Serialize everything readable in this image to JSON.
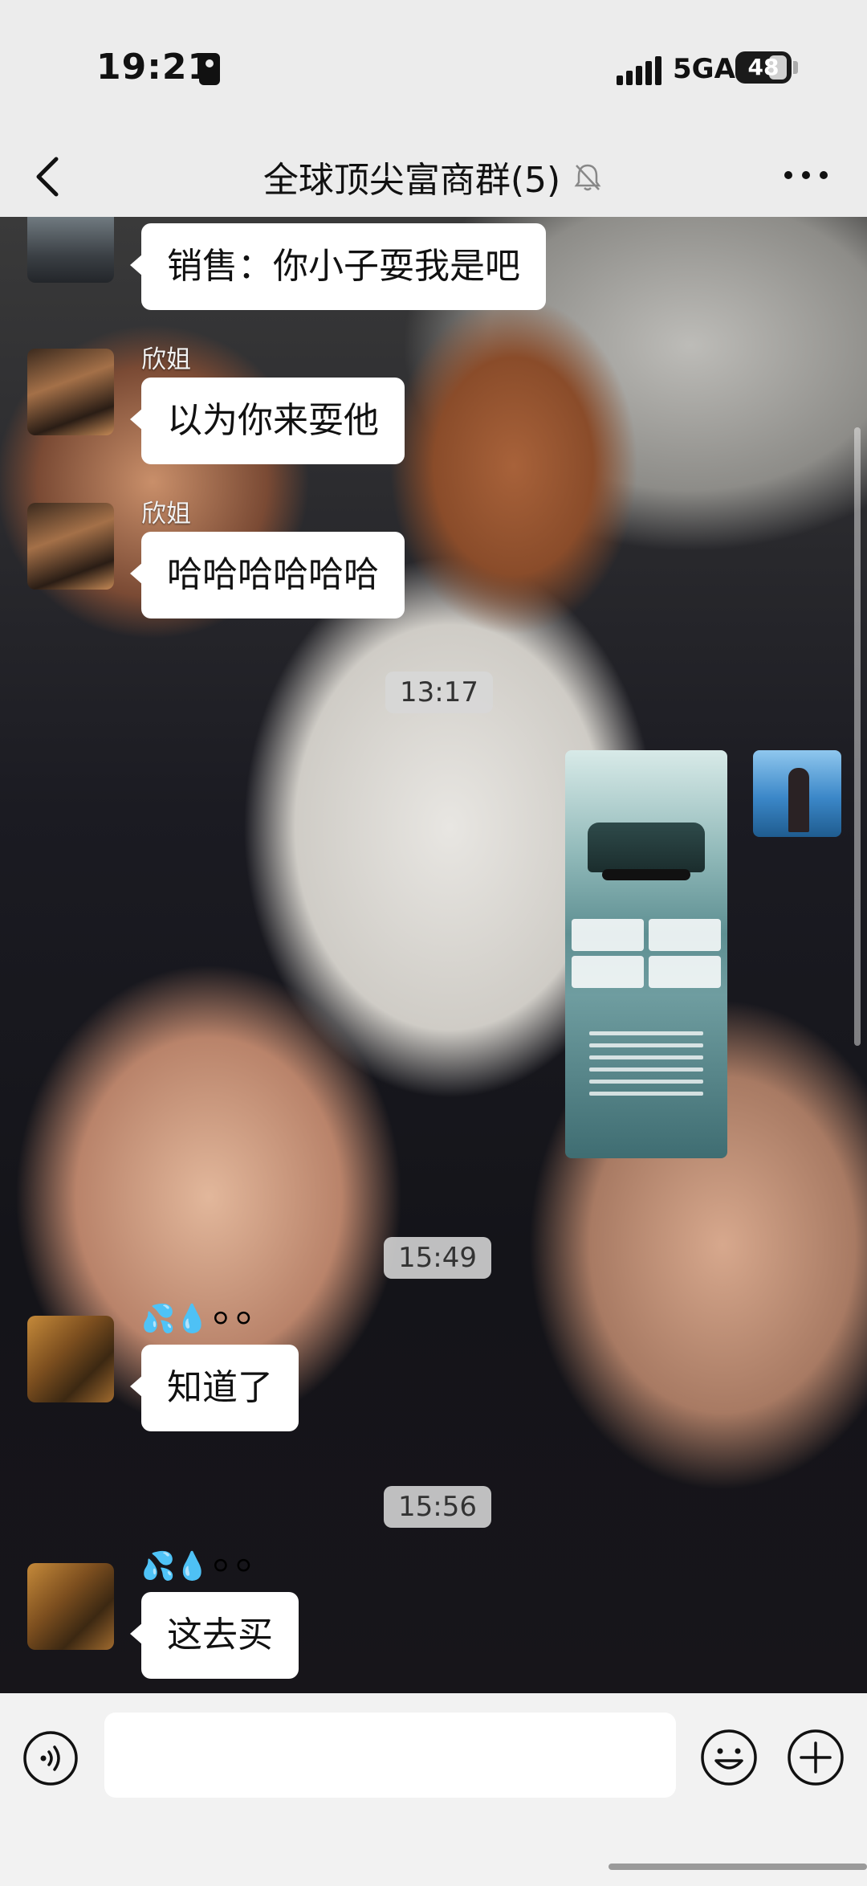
{
  "status_bar": {
    "time": "19:21",
    "network": "5GA",
    "battery": "48"
  },
  "header": {
    "title": "全球顶尖富商群(5)",
    "muted_icon": "bell-off-icon",
    "more_icon": "more-icon"
  },
  "messages": [
    {
      "type": "text",
      "sender": "",
      "text": "销售：你小子耍我是吧"
    },
    {
      "type": "text",
      "sender": "欣姐",
      "text": "以为你来耍他"
    },
    {
      "type": "text",
      "sender": "欣姐",
      "text": "哈哈哈哈哈哈"
    },
    {
      "type": "time",
      "text": "13:17"
    },
    {
      "type": "image",
      "sender": "self",
      "content": "car-price-poster"
    },
    {
      "type": "time",
      "text": "15:49"
    },
    {
      "type": "text",
      "sender": "💦💧⚪⚪",
      "text": "知道了"
    },
    {
      "type": "time",
      "text": "15:56"
    },
    {
      "type": "text",
      "sender": "💦💧⚪⚪",
      "text": "这去买"
    }
  ],
  "input": {
    "placeholder": ""
  }
}
